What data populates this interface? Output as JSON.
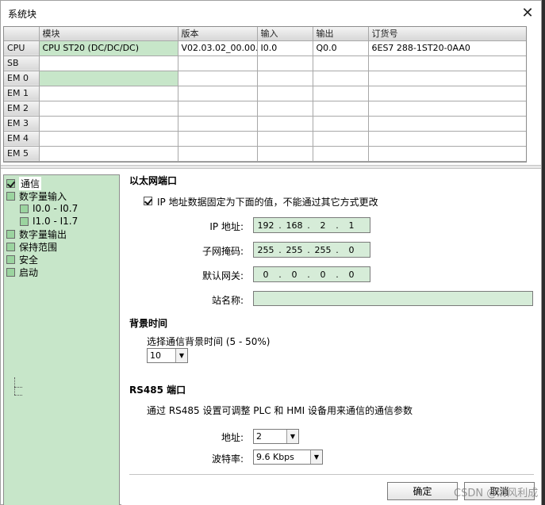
{
  "window": {
    "title": "系统块",
    "close_icon": "close-icon"
  },
  "config_table": {
    "columns": [
      "模块",
      "版本",
      "输入",
      "输出",
      "订货号"
    ],
    "rows": [
      {
        "slot": "CPU",
        "module": "CPU ST20 (DC/DC/DC)",
        "version": "V02.03.02_00.00...",
        "input": "I0.0",
        "output": "Q0.0",
        "order": "6ES7 288-1ST20-0AA0"
      },
      {
        "slot": "SB",
        "module": "",
        "version": "",
        "input": "",
        "output": "",
        "order": ""
      },
      {
        "slot": "EM 0",
        "module": "",
        "version": "",
        "input": "",
        "output": "",
        "order": ""
      },
      {
        "slot": "EM 1",
        "module": "",
        "version": "",
        "input": "",
        "output": "",
        "order": ""
      },
      {
        "slot": "EM 2",
        "module": "",
        "version": "",
        "input": "",
        "output": "",
        "order": ""
      },
      {
        "slot": "EM 3",
        "module": "",
        "version": "",
        "input": "",
        "output": "",
        "order": ""
      },
      {
        "slot": "EM 4",
        "module": "",
        "version": "",
        "input": "",
        "output": "",
        "order": ""
      },
      {
        "slot": "EM 5",
        "module": "",
        "version": "",
        "input": "",
        "output": "",
        "order": ""
      }
    ]
  },
  "tree": {
    "items": [
      {
        "label": "通信",
        "checked": true
      },
      {
        "label": "数字量输入",
        "checked": false
      },
      {
        "label": "I0.0 - I0.7",
        "checked": false
      },
      {
        "label": "I1.0 - I1.7",
        "checked": false
      },
      {
        "label": "数字量输出",
        "checked": false
      },
      {
        "label": "保持范围",
        "checked": false
      },
      {
        "label": "安全",
        "checked": false
      },
      {
        "label": "启动",
        "checked": false
      }
    ]
  },
  "ethernet": {
    "heading": "以太网端口",
    "fixed_ip_label": "IP 地址数据固定为下面的值，不能通过其它方式更改",
    "fixed_ip_checked": true,
    "ip_label": "IP 地址:",
    "ip": [
      "192",
      "168",
      "2",
      "1"
    ],
    "subnet_label": "子网掩码:",
    "subnet": [
      "255",
      "255",
      "255",
      "0"
    ],
    "gateway_label": "默认网关:",
    "gateway": [
      "0",
      "0",
      "0",
      "0"
    ],
    "station_label": "站名称:",
    "station_name": ""
  },
  "background_time": {
    "heading": "背景时间",
    "label": "选择通信背景时间 (5 - 50%)",
    "value": "10"
  },
  "rs485": {
    "heading": "RS485 端口",
    "description": "通过 RS485 设置可调整 PLC 和 HMI 设备用来通信的通信参数",
    "address_label": "地址:",
    "address": "2",
    "baud_label": "波特率:",
    "baud": "9.6 Kbps"
  },
  "buttons": {
    "ok": "确定",
    "cancel": "取消"
  },
  "watermark": "CSDN @清风利成"
}
